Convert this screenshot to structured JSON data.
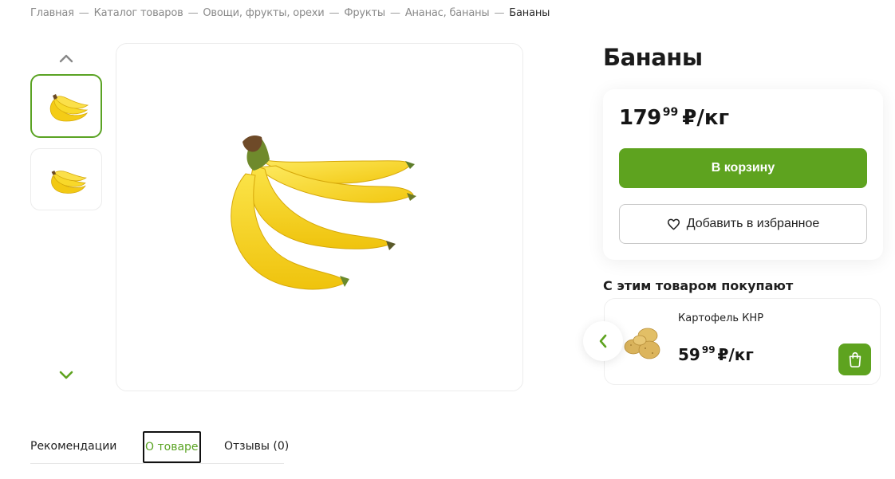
{
  "breadcrumb": {
    "items": [
      "Главная",
      "Каталог товаров",
      "Овощи, фрукты, орехи",
      "Фрукты",
      "Ананас, бананы"
    ],
    "separator": "—",
    "current": "Бананы"
  },
  "gallery": {
    "up_icon": "chevron-up-icon",
    "down_icon": "chevron-down-icon",
    "thumbnails": [
      "bananas-bunch-1",
      "bananas-bunch-2"
    ],
    "active_index": 0,
    "main_image": "bananas-bunch"
  },
  "product": {
    "title": "Бананы",
    "price_rub": "179",
    "price_kop": "99",
    "price_unit": "₽/кг",
    "add_to_cart_label": "В корзину",
    "add_to_favorites_label": "Добавить в избранное",
    "favorites_icon": "heart-icon"
  },
  "related": {
    "title": "С этим товаром покупают",
    "prev_icon": "chevron-left-icon",
    "items": [
      {
        "name": "Картофель КНР",
        "price_rub": "59",
        "price_kop": "99",
        "price_unit": "₽/кг",
        "image": "potatoes",
        "cart_icon": "shopping-bag-icon"
      }
    ]
  },
  "tabs": {
    "items": [
      "Рекомендации",
      "О товаре",
      "Отзывы (0)"
    ],
    "active_index": 1
  },
  "colors": {
    "accent": "#5ea31f",
    "accent_dark": "#5aa323",
    "text": "#1f1f1f",
    "muted": "#8a8a8a",
    "banana_yellow": "#f6d21c"
  }
}
